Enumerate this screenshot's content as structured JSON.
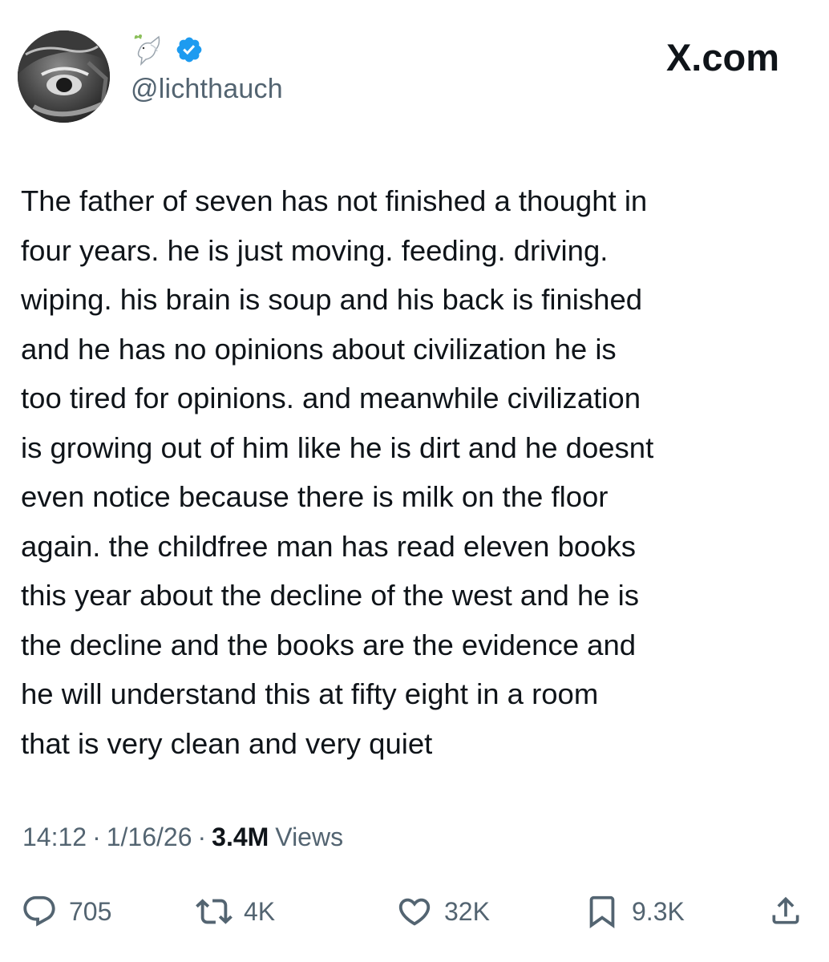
{
  "post": {
    "handle": "@lichthauch",
    "badges": {
      "emoji": "🕊",
      "verified_color": "#1d9bf0"
    },
    "brand": "X.com",
    "text_lines": [
      "The father of seven has not finished a thought in",
      "four years. he is just moving. feeding. driving.",
      "wiping. his brain is soup and his back is finished",
      "and he has no opinions about civilization he is",
      "too tired for opinions. and meanwhile civilization",
      "is growing out of him like he is dirt and he doesnt",
      "even notice because there is milk on the floor",
      "again. the childfree man has read eleven books",
      "this year about the decline of the west and he is",
      "the decline and the books are the evidence and",
      "he will understand this at fifty eight in a room",
      "that is very clean and very quiet"
    ],
    "time": "14:12",
    "date": "1/16/26",
    "separator": "·",
    "views_count": "3.4M",
    "views_label": "Views"
  },
  "actions": {
    "replies": {
      "icon": "reply-icon",
      "count": "705"
    },
    "reposts": {
      "icon": "repost-icon",
      "count": "4K"
    },
    "likes": {
      "icon": "like-icon",
      "count": "32K"
    },
    "bookmarks": {
      "icon": "bookmark-icon",
      "count": "9.3K"
    },
    "share": {
      "icon": "share-icon"
    }
  },
  "colors": {
    "text": "#0f1419",
    "secondary": "#536471",
    "verified": "#1d9bf0"
  }
}
